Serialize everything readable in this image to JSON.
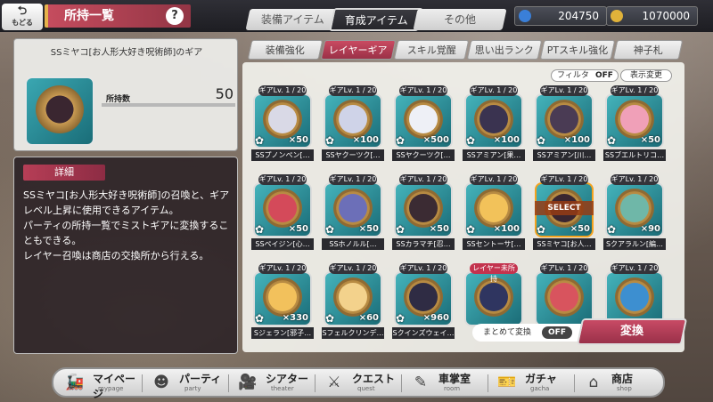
{
  "header": {
    "back_label": "もどる",
    "title": "所持一覧",
    "help_label": "?"
  },
  "category_tabs": [
    {
      "label": "装備アイテム",
      "active": false
    },
    {
      "label": "育成アイテム",
      "active": true
    },
    {
      "label": "その他",
      "active": false
    }
  ],
  "currencies": [
    {
      "icon": "gem-icon",
      "value": "204750",
      "color": "#3a7fd8"
    },
    {
      "icon": "coin-icon",
      "value": "1070000",
      "color": "#e0b23a"
    }
  ],
  "sub_tabs": [
    {
      "label": "装備強化",
      "active": false
    },
    {
      "label": "レイヤーギア",
      "active": true
    },
    {
      "label": "スキル覚醒",
      "active": false
    },
    {
      "label": "思い出ランク",
      "active": false
    },
    {
      "label": "PTスキル強化",
      "active": false
    },
    {
      "label": "神子札",
      "active": false
    }
  ],
  "selected_item": {
    "name": "SSミヤコ[お人形大好き呪術師]のギア",
    "count_label": "所持数",
    "count": "50"
  },
  "detail": {
    "tag": "詳細",
    "text": "SSミヤコ[お人形大好き呪術師]の召喚と、ギアレベル上昇に使用できるアイテム。\nパーティの所持一覧でミストギアに変換することもできる。\nレイヤー召喚は商店の交換所から行える。"
  },
  "filter": {
    "label": "フィルタ",
    "state": "OFF",
    "display_button": "表示変更"
  },
  "gears": [
    {
      "level": "ギアLv. 1 / 20",
      "qty": "×50",
      "name": "SSプノンペン[…",
      "face": "#d9d9e6"
    },
    {
      "level": "ギアLv. 1 / 20",
      "qty": "×100",
      "name": "SSヤクーツク[…",
      "face": "#cfd3e8"
    },
    {
      "level": "ギアLv. 1 / 20",
      "qty": "×500",
      "name": "SSヤクーツク[…",
      "face": "#eef0f6"
    },
    {
      "level": "ギアLv. 1 / 20",
      "qty": "×100",
      "name": "SSアミアン[果…",
      "face": "#3a3350"
    },
    {
      "level": "ギアLv. 1 / 20",
      "qty": "×100",
      "name": "SSアミアン[川…",
      "face": "#4a3b54"
    },
    {
      "level": "ギアLv. 1 / 20",
      "qty": "×50",
      "name": "SSブエルトリコ…",
      "face": "#f0a0b8"
    },
    {
      "level": "ギアLv. 1 / 20",
      "qty": "×50",
      "name": "SSペイジン[心…",
      "face": "#d44a5a"
    },
    {
      "level": "ギアLv. 1 / 20",
      "qty": "×50",
      "name": "SSホノルル[…",
      "face": "#6c6fb8"
    },
    {
      "level": "ギアLv. 1 / 20",
      "qty": "×50",
      "name": "SSカラマチ[忍…",
      "face": "#3b2b33"
    },
    {
      "level": "ギアLv. 1 / 20",
      "qty": "×100",
      "name": "SSセントーサ[…",
      "face": "#f2c25a"
    },
    {
      "level": "ギアLv. 1 / 20",
      "qty": "×50",
      "name": "SSミヤコ[お人…",
      "face": "#3a2630",
      "selected": true,
      "overlay": "SELECT"
    },
    {
      "level": "ギアLv. 1 / 20",
      "qty": "×90",
      "name": "Sクアラルン[編…",
      "face": "#6fb7a8"
    },
    {
      "level": "ギアLv. 1 / 20",
      "qty": "×330",
      "name": "Sジェラン[邪子…",
      "face": "#f2c15c"
    },
    {
      "level": "ギアLv. 1 / 20",
      "qty": "×60",
      "name": "Sフェルクリンデ…",
      "face": "#f3d28c"
    },
    {
      "level": "ギアLv. 1 / 20",
      "qty": "×960",
      "name": "Sクインズウェイ…",
      "face": "#2f2c44"
    },
    {
      "level": "レイヤー未所持",
      "qty": "",
      "name": "",
      "face": "#2f3560",
      "level_red": true
    },
    {
      "level": "ギアLv. 1 / 20",
      "qty": "",
      "name": "",
      "face": "#d8545e"
    },
    {
      "level": "ギアLv. 1 / 20",
      "qty": "",
      "name": "",
      "face": "#3d8fd0"
    }
  ],
  "bulk_convert": {
    "label": "まとめて変換",
    "state": "OFF"
  },
  "convert_button": "変換",
  "nav": [
    {
      "label": "マイページ",
      "sub": "mypage",
      "icon": "train-icon"
    },
    {
      "label": "パーティ",
      "sub": "party",
      "icon": "party-icon"
    },
    {
      "label": "シアター",
      "sub": "theater",
      "icon": "projector-icon"
    },
    {
      "label": "クエスト",
      "sub": "quest",
      "icon": "swords-icon"
    },
    {
      "label": "車掌室",
      "sub": "room",
      "icon": "pen-icon"
    },
    {
      "label": "ガチャ",
      "sub": "gacha",
      "icon": "ticket-icon"
    },
    {
      "label": "商店",
      "sub": "shop",
      "icon": "shop-icon"
    }
  ]
}
